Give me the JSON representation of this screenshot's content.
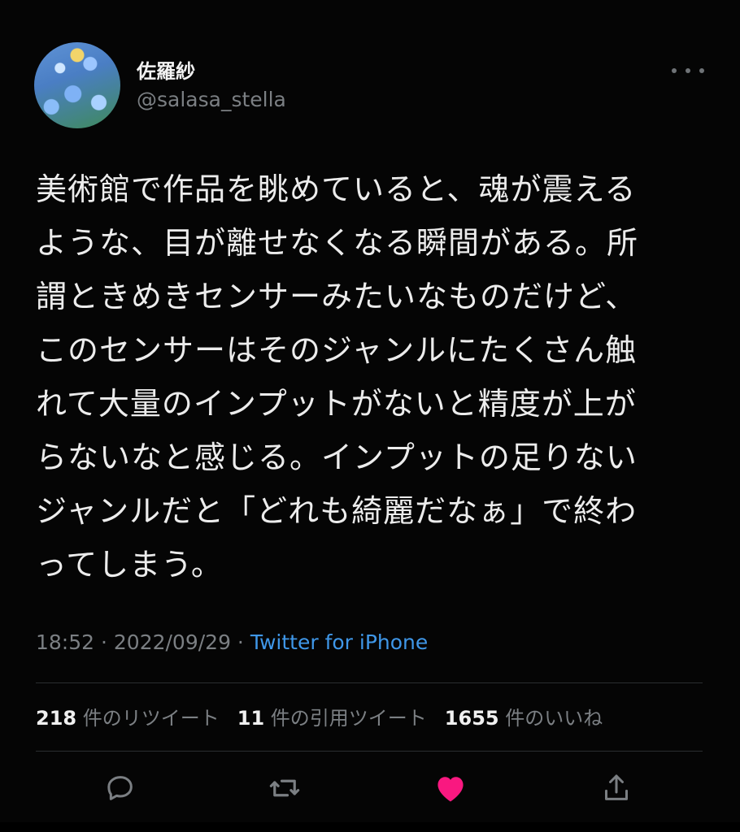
{
  "user": {
    "display_name": "佐羅紗",
    "handle": "@salasa_stella"
  },
  "tweet": {
    "text": "美術館で作品を眺めていると、魂が震える\nような、目が離せなくなる瞬間がある。所\n謂ときめきセンサーみたいなものだけど、\nこのセンサーはそのジャンルにたくさん触\nれて大量のインプットがないと精度が上が\nらないなと感じる。インプットの足りない\nジャンルだと「どれも綺麗だなぁ」で終わ\nってしまう。",
    "time": "18:52",
    "separator1": " · ",
    "date": "2022/09/29",
    "separator2": " · ",
    "source": "Twitter for iPhone"
  },
  "stats": {
    "retweets_count": "218",
    "retweets_label": "件のリツイート",
    "quotes_count": "11",
    "quotes_label": "件の引用ツイート",
    "likes_count": "1655",
    "likes_label": "件のいいね"
  },
  "icons": {
    "reply": "reply-icon",
    "retweet": "retweet-icon",
    "like": "heart-icon",
    "share": "share-icon",
    "more": "more-icon"
  },
  "colors": {
    "background": "#050505",
    "text": "#ececec",
    "muted": "#7b7f83",
    "link": "#3f97e8",
    "liked": "#f91880"
  }
}
